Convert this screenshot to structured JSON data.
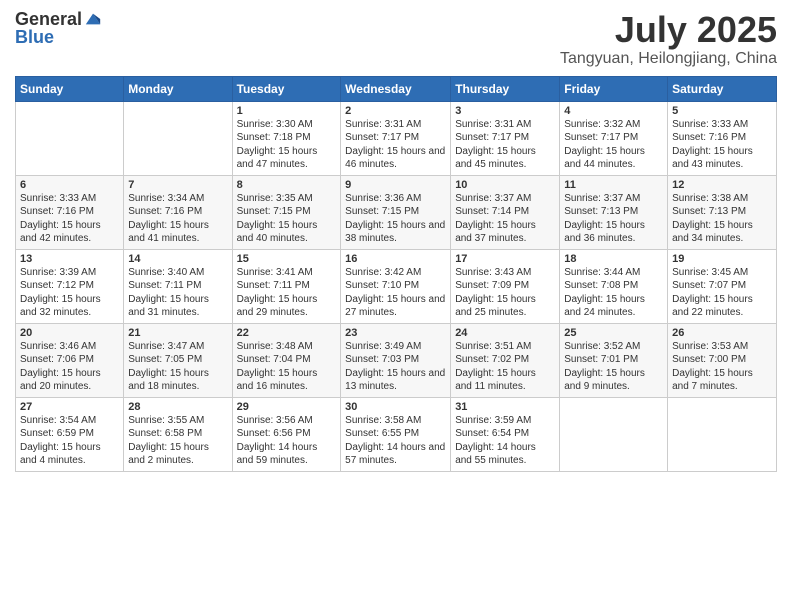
{
  "header": {
    "logo_general": "General",
    "logo_blue": "Blue",
    "main_title": "July 2025",
    "subtitle": "Tangyuan, Heilongjiang, China"
  },
  "calendar": {
    "days_of_week": [
      "Sunday",
      "Monday",
      "Tuesday",
      "Wednesday",
      "Thursday",
      "Friday",
      "Saturday"
    ],
    "weeks": [
      [
        {
          "day": "",
          "detail": ""
        },
        {
          "day": "",
          "detail": ""
        },
        {
          "day": "1",
          "detail": "Sunrise: 3:30 AM\nSunset: 7:18 PM\nDaylight: 15 hours and 47 minutes."
        },
        {
          "day": "2",
          "detail": "Sunrise: 3:31 AM\nSunset: 7:17 PM\nDaylight: 15 hours and 46 minutes."
        },
        {
          "day": "3",
          "detail": "Sunrise: 3:31 AM\nSunset: 7:17 PM\nDaylight: 15 hours and 45 minutes."
        },
        {
          "day": "4",
          "detail": "Sunrise: 3:32 AM\nSunset: 7:17 PM\nDaylight: 15 hours and 44 minutes."
        },
        {
          "day": "5",
          "detail": "Sunrise: 3:33 AM\nSunset: 7:16 PM\nDaylight: 15 hours and 43 minutes."
        }
      ],
      [
        {
          "day": "6",
          "detail": "Sunrise: 3:33 AM\nSunset: 7:16 PM\nDaylight: 15 hours and 42 minutes."
        },
        {
          "day": "7",
          "detail": "Sunrise: 3:34 AM\nSunset: 7:16 PM\nDaylight: 15 hours and 41 minutes."
        },
        {
          "day": "8",
          "detail": "Sunrise: 3:35 AM\nSunset: 7:15 PM\nDaylight: 15 hours and 40 minutes."
        },
        {
          "day": "9",
          "detail": "Sunrise: 3:36 AM\nSunset: 7:15 PM\nDaylight: 15 hours and 38 minutes."
        },
        {
          "day": "10",
          "detail": "Sunrise: 3:37 AM\nSunset: 7:14 PM\nDaylight: 15 hours and 37 minutes."
        },
        {
          "day": "11",
          "detail": "Sunrise: 3:37 AM\nSunset: 7:13 PM\nDaylight: 15 hours and 36 minutes."
        },
        {
          "day": "12",
          "detail": "Sunrise: 3:38 AM\nSunset: 7:13 PM\nDaylight: 15 hours and 34 minutes."
        }
      ],
      [
        {
          "day": "13",
          "detail": "Sunrise: 3:39 AM\nSunset: 7:12 PM\nDaylight: 15 hours and 32 minutes."
        },
        {
          "day": "14",
          "detail": "Sunrise: 3:40 AM\nSunset: 7:11 PM\nDaylight: 15 hours and 31 minutes."
        },
        {
          "day": "15",
          "detail": "Sunrise: 3:41 AM\nSunset: 7:11 PM\nDaylight: 15 hours and 29 minutes."
        },
        {
          "day": "16",
          "detail": "Sunrise: 3:42 AM\nSunset: 7:10 PM\nDaylight: 15 hours and 27 minutes."
        },
        {
          "day": "17",
          "detail": "Sunrise: 3:43 AM\nSunset: 7:09 PM\nDaylight: 15 hours and 25 minutes."
        },
        {
          "day": "18",
          "detail": "Sunrise: 3:44 AM\nSunset: 7:08 PM\nDaylight: 15 hours and 24 minutes."
        },
        {
          "day": "19",
          "detail": "Sunrise: 3:45 AM\nSunset: 7:07 PM\nDaylight: 15 hours and 22 minutes."
        }
      ],
      [
        {
          "day": "20",
          "detail": "Sunrise: 3:46 AM\nSunset: 7:06 PM\nDaylight: 15 hours and 20 minutes."
        },
        {
          "day": "21",
          "detail": "Sunrise: 3:47 AM\nSunset: 7:05 PM\nDaylight: 15 hours and 18 minutes."
        },
        {
          "day": "22",
          "detail": "Sunrise: 3:48 AM\nSunset: 7:04 PM\nDaylight: 15 hours and 16 minutes."
        },
        {
          "day": "23",
          "detail": "Sunrise: 3:49 AM\nSunset: 7:03 PM\nDaylight: 15 hours and 13 minutes."
        },
        {
          "day": "24",
          "detail": "Sunrise: 3:51 AM\nSunset: 7:02 PM\nDaylight: 15 hours and 11 minutes."
        },
        {
          "day": "25",
          "detail": "Sunrise: 3:52 AM\nSunset: 7:01 PM\nDaylight: 15 hours and 9 minutes."
        },
        {
          "day": "26",
          "detail": "Sunrise: 3:53 AM\nSunset: 7:00 PM\nDaylight: 15 hours and 7 minutes."
        }
      ],
      [
        {
          "day": "27",
          "detail": "Sunrise: 3:54 AM\nSunset: 6:59 PM\nDaylight: 15 hours and 4 minutes."
        },
        {
          "day": "28",
          "detail": "Sunrise: 3:55 AM\nSunset: 6:58 PM\nDaylight: 15 hours and 2 minutes."
        },
        {
          "day": "29",
          "detail": "Sunrise: 3:56 AM\nSunset: 6:56 PM\nDaylight: 14 hours and 59 minutes."
        },
        {
          "day": "30",
          "detail": "Sunrise: 3:58 AM\nSunset: 6:55 PM\nDaylight: 14 hours and 57 minutes."
        },
        {
          "day": "31",
          "detail": "Sunrise: 3:59 AM\nSunset: 6:54 PM\nDaylight: 14 hours and 55 minutes."
        },
        {
          "day": "",
          "detail": ""
        },
        {
          "day": "",
          "detail": ""
        }
      ]
    ]
  }
}
